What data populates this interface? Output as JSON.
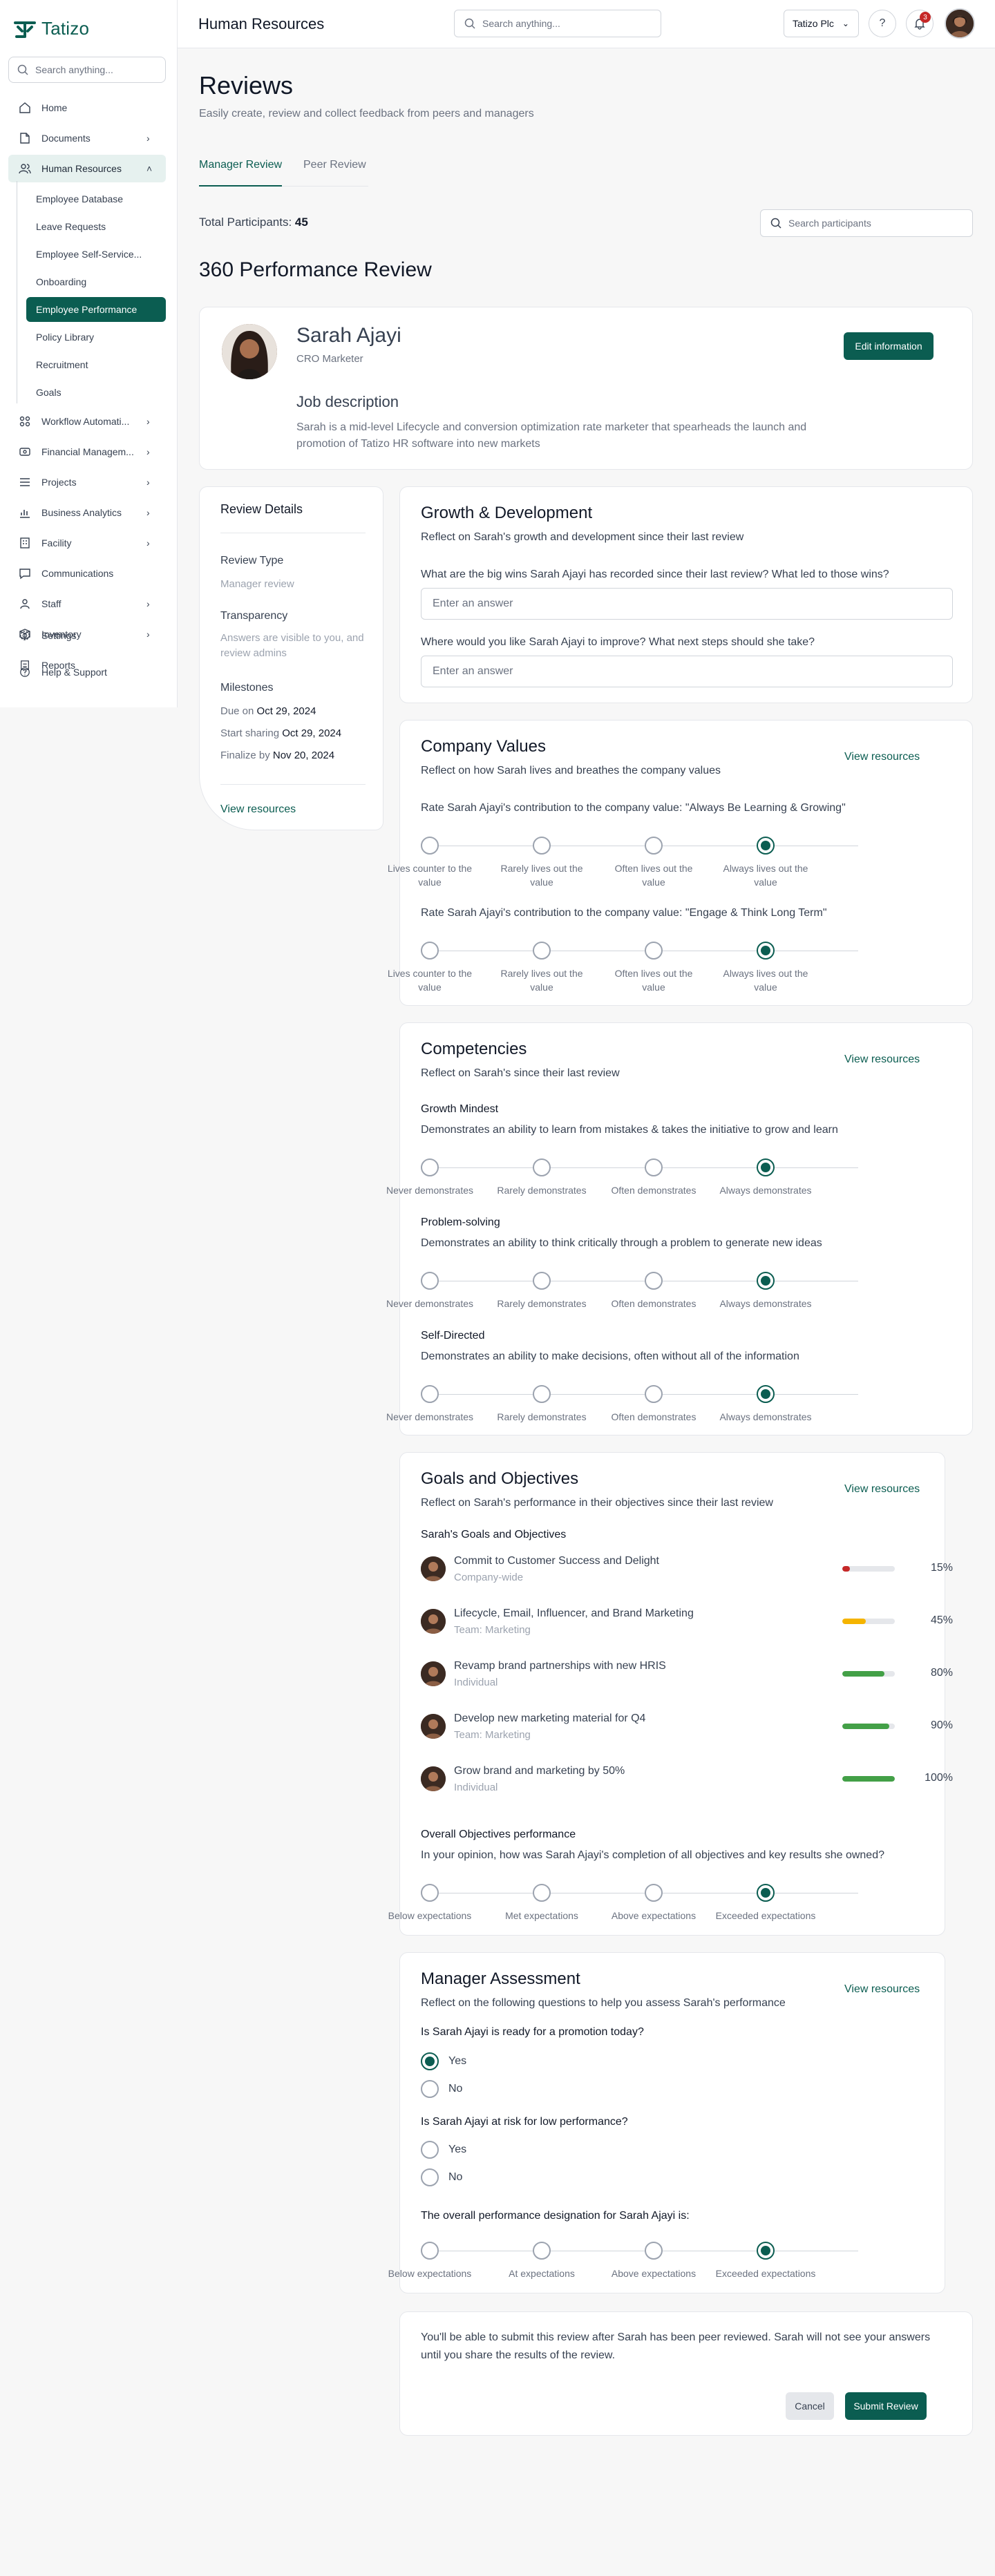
{
  "app": {
    "name": "Tatizo",
    "brand_color": "#0b5d51"
  },
  "sidebar": {
    "search_placeholder": "Search anything...",
    "items": [
      {
        "label": "Home",
        "icon": "home-icon"
      },
      {
        "label": "Documents",
        "icon": "document-icon"
      },
      {
        "label": "Human Resources",
        "icon": "users-icon"
      },
      {
        "label": "Workflow Automati...",
        "icon": "workflow-icon"
      },
      {
        "label": "Financial Managem...",
        "icon": "finance-icon"
      },
      {
        "label": "Projects",
        "icon": "projects-icon"
      },
      {
        "label": "Business Analytics",
        "icon": "analytics-icon"
      },
      {
        "label": "Facility",
        "icon": "building-icon"
      },
      {
        "label": "Communications",
        "icon": "chat-icon"
      },
      {
        "label": "Staff",
        "icon": "staff-icon"
      },
      {
        "label": "Inventory",
        "icon": "inventory-icon"
      },
      {
        "label": "Reports",
        "icon": "reports-icon"
      },
      {
        "label": "Settings",
        "icon": "settings-icon"
      },
      {
        "label": "Help & Support",
        "icon": "help-icon"
      }
    ],
    "hr_sub": [
      "Employee Database",
      "Leave Requests",
      "Employee Self-Service...",
      "Onboarding",
      "Employee Performance",
      "Policy Library",
      "Recruitment",
      "Goals"
    ]
  },
  "header": {
    "title": "Human Resources",
    "search_placeholder": "Search anything...",
    "company": "Tatizo Plc",
    "notifications": "3"
  },
  "page": {
    "title": "Reviews",
    "subtitle": "Easily create, review and collect feedback from peers and managers",
    "tabs": [
      "Manager Review",
      "Peer Review"
    ],
    "participants_label": "Total Participants:",
    "participants_count": "45",
    "participants_search": "Search participants",
    "section_title": "360 Performance Review"
  },
  "profile": {
    "name": "Sarah Ajayi",
    "role": "CRO Marketer",
    "edit_label": "Edit information",
    "jd_title": "Job description",
    "jd_text": "Sarah is a mid-level Lifecycle and conversion optimization rate marketer that spearheads the launch and promotion of Tatizo HR software into new markets"
  },
  "review_details": {
    "title": "Review Details",
    "type_label": "Review Type",
    "type_value": "Manager review",
    "transparency_label": "Transparency",
    "transparency_value": "Answers are visible to you, and review admins",
    "milestones_label": "Milestones",
    "due_prefix": "Due on",
    "due_date": "Oct 29, 2024",
    "start_prefix": "Start sharing",
    "start_date": "Oct 29, 2024",
    "finalize_prefix": "Finalize by",
    "finalize_date": "Nov 20, 2024",
    "link": "View resources"
  },
  "growth": {
    "title": "Growth & Development",
    "subtitle": "Reflect on Sarah's growth and development since their last review",
    "q1": "What are the big wins Sarah Ajayi has recorded since their last review? What led to those wins?",
    "q2": "Where would you like Sarah Ajayi to improve? What next steps should she take?",
    "placeholder": "Enter an answer"
  },
  "values": {
    "title": "Company Values",
    "subtitle": "Reflect on how Sarah lives and breathes the company values",
    "link": "View resources",
    "q1": "Rate Sarah Ajayi's contribution to the company value: \"Always Be Learning & Growing\"",
    "q2": "Rate Sarah Ajayi's contribution to the company value: \"Engage & Think Long Term\"",
    "labels": [
      "Lives counter to the value",
      "Rarely lives out the value",
      "Often lives out the value",
      "Always lives out the value"
    ],
    "selected": [
      3,
      3
    ]
  },
  "competencies": {
    "title": "Competencies",
    "subtitle": "Reflect on Sarah's since their last review",
    "link": "View resources",
    "items": [
      {
        "name": "Growth Mindest",
        "desc": "Demonstrates an ability to learn from mistakes & takes the initiative to grow and learn",
        "selected": 3
      },
      {
        "name": "Problem-solving",
        "desc": "Demonstrates an ability to think critically through a problem to generate new ideas",
        "selected": 3
      },
      {
        "name": "Self-Directed",
        "desc": "Demonstrates an ability to make decisions, often without all of the information",
        "selected": 3
      }
    ],
    "labels": [
      "Never demonstrates",
      "Rarely demonstrates",
      "Often demonstrates",
      "Always demonstrates"
    ]
  },
  "goals": {
    "title": "Goals and Objectives",
    "subtitle": "Reflect on Sarah's performance in their objectives since their last review",
    "link": "View resources",
    "list_title": "Sarah's Goals and Objectives",
    "items": [
      {
        "title": "Commit to Customer Success and Delight",
        "scope": "Company-wide",
        "progress": 15,
        "pct": "15%",
        "color": "#c62828"
      },
      {
        "title": "Lifecycle, Email, Influencer, and Brand Marketing",
        "scope": "Team: Marketing",
        "progress": 45,
        "pct": "45%",
        "color": "#f5b400"
      },
      {
        "title": "Revamp brand partnerships with new HRIS",
        "scope": "Individual",
        "progress": 80,
        "pct": "80%",
        "color": "#43a047"
      },
      {
        "title": "Develop new marketing material for Q4",
        "scope": "Team: Marketing",
        "progress": 90,
        "pct": "90%",
        "color": "#43a047"
      },
      {
        "title": "Grow brand and marketing by 50%",
        "scope": "Individual",
        "progress": 100,
        "pct": "100%",
        "color": "#43a047"
      }
    ],
    "overall_title": "Overall Objectives performance",
    "overall_q": "In your opinion, how was Sarah Ajayi's completion of all objectives and key results she owned?",
    "labels": [
      "Below expectations",
      "Met expectations",
      "Above expectations",
      "Exceeded expectations"
    ],
    "selected": 3
  },
  "assessment": {
    "title": "Manager Assessment",
    "subtitle": "Reflect on the following questions to help you assess Sarah's performance",
    "link": "View resources",
    "q1": "Is Sarah Ajayi is ready for a promotion today?",
    "q2": "Is Sarah Ajayi at risk for low performance?",
    "yes": "Yes",
    "no": "No",
    "q1_selected": "yes",
    "q3": "The overall performance designation for Sarah Ajayi is:",
    "labels": [
      "Below expectations",
      "At expectations",
      "Above expectations",
      "Exceeded expectations"
    ],
    "selected": 3
  },
  "submit": {
    "note": "You'll be able to submit this review after Sarah has been peer reviewed. Sarah will not see your answers until you share the results of the review.",
    "cancel": "Cancel",
    "submit": "Submit Review"
  }
}
